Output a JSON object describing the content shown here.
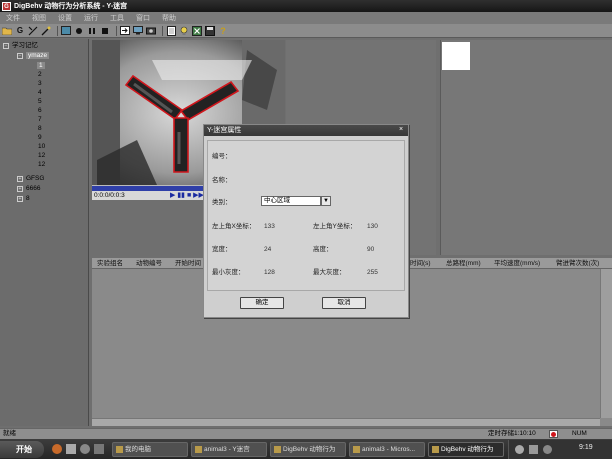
{
  "window": {
    "title": "DigBehv 动物行为分析系统 - Y-迷宫",
    "menus": [
      "文件",
      "视图",
      "设置",
      "运行",
      "工具",
      "窗口",
      "帮助"
    ]
  },
  "toolbar": {
    "icons": [
      "open-folder-icon",
      "g-icon",
      "measure-icon",
      "wand-icon",
      "screen-icon",
      "record-icon",
      "pause-icon",
      "stop-icon",
      "enter-icon",
      "monitor-icon",
      "camera-icon",
      "document-icon",
      "light-icon",
      "excel-icon",
      "save-icon",
      "help-icon"
    ],
    "g_label": "G"
  },
  "tree": {
    "root": "学习记忆",
    "child": "ymaze",
    "items": [
      "1",
      "2",
      "3",
      "4",
      "5",
      "6",
      "7",
      "8",
      "9",
      "10",
      "12"
    ],
    "last_item": "12",
    "groups": [
      "GFSG",
      "6666",
      "8"
    ]
  },
  "video": {
    "time": "0:0:0/0:0:3",
    "controls": "▶ ▮▮ ■ ▶▶"
  },
  "table": {
    "columns": [
      "实验组名",
      "动物编号",
      "开始时间",
      "时间(s)",
      "总路程(mm)",
      "平均速度(mm/s)",
      "臂进臂次数(次)"
    ]
  },
  "dialog": {
    "title": "Y-迷宫属性",
    "close": "×",
    "fields": {
      "number_label": "编号：",
      "name_label": "名称：",
      "type_label": "类别：",
      "type_value": "中心区域",
      "x_label": "左上角X坐标：",
      "x_value": "133",
      "y_label": "左上角Y坐标：",
      "y_value": "130",
      "width_label": "宽度：",
      "width_value": "24",
      "height_label": "高度：",
      "height_value": "90",
      "min_gray_label": "最小灰度：",
      "min_gray_value": "128",
      "max_gray_label": "最大灰度：",
      "max_gray_value": "255"
    },
    "ok": "确定",
    "cancel": "取消"
  },
  "status": {
    "left": "就绪",
    "timer": "定时存储1:10:10",
    "num": "NUM"
  },
  "taskbar": {
    "start": "开始",
    "tasks": [
      "我的电脑",
      "animal3 - Y迷宫",
      "DigBehv 动物行为",
      "animal3 - Micros...",
      "DigBehv 动物行为"
    ],
    "clock": "9:19"
  },
  "colors": {
    "maze_outline": "#d0161c",
    "progress": "#2f3fa8"
  }
}
